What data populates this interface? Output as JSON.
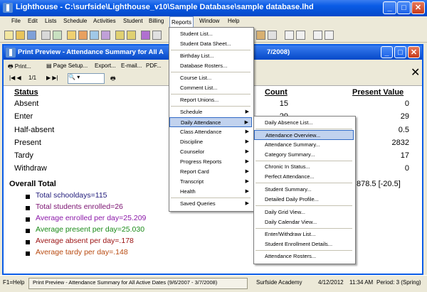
{
  "app": {
    "title": "Lighthouse  -  C:\\surfside\\Lighthouse_v10\\Sample Database\\sample database.lhd"
  },
  "menubar": [
    "File",
    "Edit",
    "Lists",
    "Schedule",
    "Activities",
    "Student",
    "Billing",
    "Reports",
    "Window",
    "Help"
  ],
  "child_window": {
    "title": "Print Preview - Attendance Summary for All Active Dates (9/6/2007 - 3/7/2008)",
    "title_visible_start": "Print Preview - Attendance Summary for All A",
    "title_visible_end": "7/2008)",
    "toolbar": {
      "print": "Print...",
      "page_setup": "Page Setup...",
      "export": "Export...",
      "email": "E-mail...",
      "pdf": "PDF...",
      "page": "1/1"
    }
  },
  "report": {
    "headers": {
      "status": "Status",
      "count": "Count",
      "present_value": "Present Value"
    },
    "rows": [
      {
        "status": "Absent",
        "count": "15",
        "value": "0"
      },
      {
        "status": "Enter",
        "count": "29",
        "value": "29"
      },
      {
        "status": "Half-absent",
        "count": "",
        "value": "0.5"
      },
      {
        "status": "Present",
        "count": "",
        "value": "2832"
      },
      {
        "status": "Tardy",
        "count": "",
        "value": "17"
      },
      {
        "status": "Withdraw",
        "count": "",
        "value": "0"
      }
    ],
    "overall_label": "Overall Total",
    "overall_value": "878.5 [-20.5]",
    "summary": [
      {
        "text": "Total schooldays=115",
        "color": "#1f1a7a"
      },
      {
        "text": "Total students enrolled=26",
        "color": "#7a1070"
      },
      {
        "text": "Average enrolled per day=25.209",
        "color": "#8b18a8"
      },
      {
        "text": "Average present per day=25.030",
        "color": "#1a8a18"
      },
      {
        "text": "Average absent per day=.178",
        "color": "#9a1010"
      },
      {
        "text": "Average tardy per day=.148",
        "color": "#b84a10"
      }
    ]
  },
  "reports_menu": [
    {
      "label": "Student List...",
      "arrow": false
    },
    {
      "label": "Student Data Sheet...",
      "arrow": false
    },
    {
      "label": "Birthday List...",
      "arrow": false
    },
    {
      "label": "Database Rosters...",
      "arrow": false
    },
    {
      "label": "Course List...",
      "arrow": false
    },
    {
      "label": "Comment List...",
      "arrow": false
    },
    {
      "label": "Report Unions...",
      "arrow": false
    },
    {
      "label": "Schedule",
      "arrow": true
    },
    {
      "label": "Daily Attendance",
      "arrow": true
    },
    {
      "label": "Class Attendance",
      "arrow": true
    },
    {
      "label": "Discipline",
      "arrow": true
    },
    {
      "label": "Counselor",
      "arrow": true
    },
    {
      "label": "Progress Reports",
      "arrow": true
    },
    {
      "label": "Report Card",
      "arrow": true
    },
    {
      "label": "Transcript",
      "arrow": true
    },
    {
      "label": "Health",
      "arrow": true
    },
    {
      "label": "Saved Queries",
      "arrow": true
    }
  ],
  "daily_attendance_menu": [
    "Daily Absence List...",
    "Attendance Overview...",
    "Attendance Summary...",
    "Category Summary...",
    "Chronic In Status...",
    "Perfect Attendance...",
    "Student Summary...",
    "Detailed Daily Profile...",
    "Daily Grid View...",
    "Daily Calendar View...",
    "Enter/Withdraw List...",
    "Student Enrollment Details...",
    "Attendance Rosters..."
  ],
  "statusbar": {
    "help": "F1=Help",
    "task": "Print Preview - Attendance Summary for All Active Dates (9/6/2007 - 3/7/2008)",
    "school": "Surfside Academy",
    "date": "4/12/2012",
    "time": "11:34 AM",
    "period": "Period: 3 (Spring)"
  }
}
